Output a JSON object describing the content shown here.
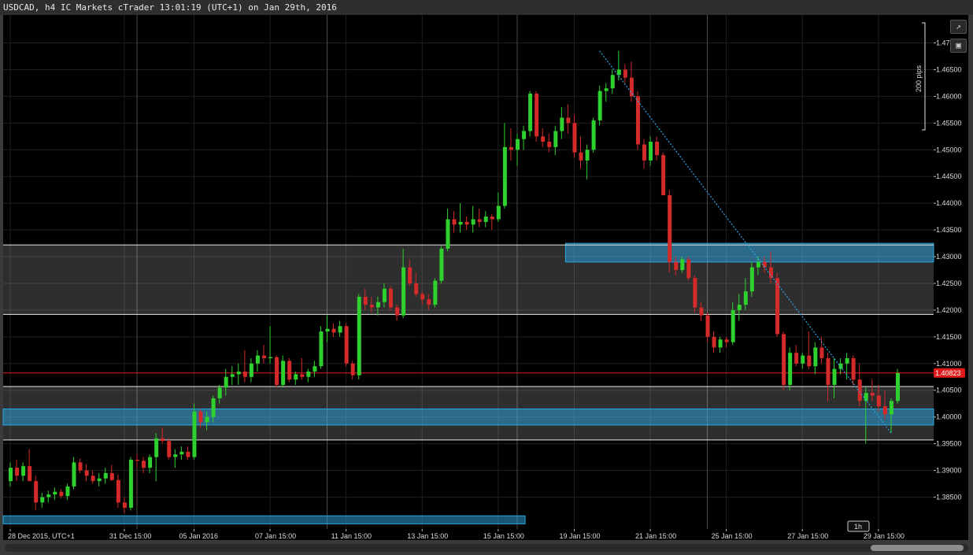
{
  "window": {
    "title": "USDCAD, h4 IC Markets cTrader 13:01:19 (UTC+1) on Jan 29th, 2016"
  },
  "toolbar": {
    "popout_icon": "↗",
    "camera_icon": "▣"
  },
  "colors": {
    "bull": "#2fd12f",
    "bear": "#d42a2a",
    "zone_fill": "#2a9fd6",
    "zone_border": "#29a8e0",
    "price_line": "#e01a1a",
    "trendline": "#2aa7e6",
    "bg": "#000000"
  },
  "chart_data": {
    "type": "candlestick",
    "symbol": "USDCAD",
    "timeframe": "h4",
    "ylim": [
      1.38,
      1.472
    ],
    "yticks": [
      "1.47",
      "1.46500",
      "1.46000",
      "1.45500",
      "1.45000",
      "1.44500",
      "1.44000",
      "1.43500",
      "1.43000",
      "1.42500",
      "1.42000",
      "1.41500",
      "1.41000",
      "1.40500",
      "1.40000",
      "1.39500",
      "1.39000",
      "1.38500"
    ],
    "ytick_values": [
      1.47,
      1.465,
      1.46,
      1.455,
      1.45,
      1.445,
      1.44,
      1.435,
      1.43,
      1.425,
      1.42,
      1.415,
      1.41,
      1.405,
      1.4,
      1.395,
      1.39,
      1.385
    ],
    "xticks": [
      "28 Dec 2015, UTC+1",
      "31 Dec 15:00",
      "05 Jan 2016",
      "07 Jan 15:00",
      "11 Jan 15:00",
      "13 Jan 15:00",
      "15 Jan 15:00",
      "19 Jan 15:00",
      "21 Jan 15:00",
      "25 Jan 15:00",
      "27 Jan 15:00",
      "29 Jan 15:00"
    ],
    "xtick_index": [
      0,
      18,
      29,
      41,
      53,
      65,
      77,
      89,
      101,
      113,
      125,
      137
    ],
    "current_price": "1.40823",
    "current_price_value": 1.40823,
    "scale_label": "200 pips",
    "period_label": "1h",
    "horizontal_lines": [
      1.4322,
      1.4192,
      1.4057,
      1.3957
    ],
    "zones": [
      {
        "from_index": 0,
        "to_index": 999,
        "top": 1.4322,
        "bottom": 1.4192,
        "style": "grey"
      },
      {
        "from_index": 0,
        "to_index": 999,
        "top": 1.4057,
        "bottom": 1.3957,
        "style": "grey"
      },
      {
        "from_index": 88,
        "to_index": 999,
        "top": 1.4325,
        "bottom": 1.429,
        "style": "blue"
      },
      {
        "from_index": 0,
        "to_index": 999,
        "top": 1.4015,
        "bottom": 1.3985,
        "style": "blue"
      },
      {
        "from_index": 0,
        "to_index": 81,
        "top": 1.3815,
        "bottom": 1.38,
        "style": "blue"
      }
    ],
    "trendline": {
      "from_index": 93,
      "from_price": 1.4685,
      "to_index": 139,
      "to_price": 1.397
    },
    "ohlc": [
      [
        1.388,
        1.3915,
        1.387,
        1.3905
      ],
      [
        1.3905,
        1.392,
        1.388,
        1.389
      ],
      [
        1.389,
        1.3915,
        1.388,
        1.3908
      ],
      [
        1.3908,
        1.394,
        1.389,
        1.388
      ],
      [
        1.388,
        1.389,
        1.3825,
        1.384
      ],
      [
        1.384,
        1.3858,
        1.383,
        1.385
      ],
      [
        1.385,
        1.3862,
        1.384,
        1.3855
      ],
      [
        1.3855,
        1.3868,
        1.3845,
        1.386
      ],
      [
        1.386,
        1.3865,
        1.3848,
        1.3852
      ],
      [
        1.3852,
        1.3875,
        1.3845,
        1.387
      ],
      [
        1.387,
        1.3925,
        1.3865,
        1.3915
      ],
      [
        1.3915,
        1.3922,
        1.3895,
        1.39
      ],
      [
        1.39,
        1.3912,
        1.388,
        1.389
      ],
      [
        1.389,
        1.39,
        1.3875,
        1.388
      ],
      [
        1.388,
        1.3895,
        1.387,
        1.3885
      ],
      [
        1.3885,
        1.3905,
        1.3875,
        1.3895
      ],
      [
        1.3895,
        1.391,
        1.388,
        1.3882
      ],
      [
        1.3882,
        1.3892,
        1.383,
        1.384
      ],
      [
        1.384,
        1.385,
        1.382,
        1.383
      ],
      [
        1.383,
        1.3925,
        1.3825,
        1.392
      ],
      [
        1.392,
        1.393,
        1.3905,
        1.3918
      ],
      [
        1.3918,
        1.3925,
        1.3895,
        1.3905
      ],
      [
        1.3905,
        1.393,
        1.3895,
        1.3925
      ],
      [
        1.3925,
        1.397,
        1.388,
        1.396
      ],
      [
        1.396,
        1.398,
        1.395,
        1.3955
      ],
      [
        1.3955,
        1.396,
        1.392,
        1.3925
      ],
      [
        1.3925,
        1.394,
        1.3905,
        1.393
      ],
      [
        1.393,
        1.3945,
        1.392,
        1.3935
      ],
      [
        1.3935,
        1.3945,
        1.392,
        1.3925
      ],
      [
        1.3925,
        1.4025,
        1.392,
        1.401
      ],
      [
        1.401,
        1.4015,
        1.398,
        1.399
      ],
      [
        1.399,
        1.401,
        1.3975,
        1.4
      ],
      [
        1.4,
        1.404,
        1.399,
        1.4035
      ],
      [
        1.4035,
        1.406,
        1.4025,
        1.4055
      ],
      [
        1.4055,
        1.409,
        1.404,
        1.4075
      ],
      [
        1.4075,
        1.4095,
        1.406,
        1.408
      ],
      [
        1.408,
        1.41,
        1.406,
        1.4085
      ],
      [
        1.4085,
        1.4125,
        1.4065,
        1.4075
      ],
      [
        1.4075,
        1.411,
        1.4065,
        1.41
      ],
      [
        1.41,
        1.4125,
        1.4085,
        1.4115
      ],
      [
        1.4115,
        1.4135,
        1.41,
        1.411
      ],
      [
        1.411,
        1.417,
        1.41,
        1.4112
      ],
      [
        1.4112,
        1.4115,
        1.4055,
        1.406
      ],
      [
        1.406,
        1.4115,
        1.4055,
        1.4105
      ],
      [
        1.4105,
        1.411,
        1.4065,
        1.407
      ],
      [
        1.407,
        1.4085,
        1.406,
        1.408
      ],
      [
        1.408,
        1.411,
        1.407,
        1.4075
      ],
      [
        1.4075,
        1.409,
        1.4065,
        1.4085
      ],
      [
        1.4085,
        1.4105,
        1.4075,
        1.4095
      ],
      [
        1.4095,
        1.417,
        1.409,
        1.416
      ],
      [
        1.416,
        1.419,
        1.414,
        1.4165
      ],
      [
        1.4165,
        1.4175,
        1.415,
        1.4158
      ],
      [
        1.4158,
        1.418,
        1.415,
        1.417
      ],
      [
        1.417,
        1.4175,
        1.4095,
        1.41
      ],
      [
        1.41,
        1.4105,
        1.407,
        1.4078
      ],
      [
        1.4078,
        1.423,
        1.407,
        1.4225
      ],
      [
        1.4225,
        1.424,
        1.42,
        1.421
      ],
      [
        1.421,
        1.4225,
        1.4195,
        1.4205
      ],
      [
        1.4205,
        1.4225,
        1.419,
        1.4215
      ],
      [
        1.4215,
        1.425,
        1.4205,
        1.424
      ],
      [
        1.424,
        1.4245,
        1.42,
        1.4205
      ],
      [
        1.4205,
        1.421,
        1.418,
        1.419
      ],
      [
        1.419,
        1.4315,
        1.4185,
        1.428
      ],
      [
        1.428,
        1.4295,
        1.4245,
        1.425
      ],
      [
        1.425,
        1.427,
        1.4225,
        1.423
      ],
      [
        1.423,
        1.4235,
        1.421,
        1.422
      ],
      [
        1.422,
        1.423,
        1.42,
        1.421
      ],
      [
        1.421,
        1.426,
        1.4205,
        1.4255
      ],
      [
        1.4255,
        1.432,
        1.425,
        1.4315
      ],
      [
        1.4315,
        1.439,
        1.431,
        1.437
      ],
      [
        1.437,
        1.4385,
        1.4345,
        1.436
      ],
      [
        1.436,
        1.44,
        1.4345,
        1.4365
      ],
      [
        1.4365,
        1.4375,
        1.435,
        1.436
      ],
      [
        1.436,
        1.4395,
        1.4345,
        1.437
      ],
      [
        1.437,
        1.439,
        1.4355,
        1.4365
      ],
      [
        1.4365,
        1.4385,
        1.4355,
        1.4375
      ],
      [
        1.4375,
        1.438,
        1.435,
        1.437
      ],
      [
        1.437,
        1.442,
        1.4365,
        1.4395
      ],
      [
        1.4395,
        1.455,
        1.439,
        1.4505
      ],
      [
        1.4505,
        1.454,
        1.448,
        1.45
      ],
      [
        1.45,
        1.453,
        1.447,
        1.452
      ],
      [
        1.452,
        1.4545,
        1.45,
        1.4535
      ],
      [
        1.4535,
        1.461,
        1.4525,
        1.4605
      ],
      [
        1.4605,
        1.461,
        1.4515,
        1.4525
      ],
      [
        1.4525,
        1.454,
        1.4505,
        1.4515
      ],
      [
        1.4515,
        1.453,
        1.4495,
        1.4505
      ],
      [
        1.4505,
        1.4545,
        1.449,
        1.4535
      ],
      [
        1.4535,
        1.458,
        1.452,
        1.456
      ],
      [
        1.456,
        1.4585,
        1.453,
        1.455
      ],
      [
        1.455,
        1.4565,
        1.4485,
        1.4495
      ],
      [
        1.4495,
        1.4525,
        1.4465,
        1.448
      ],
      [
        1.448,
        1.451,
        1.4445,
        1.45
      ],
      [
        1.45,
        1.456,
        1.4495,
        1.4555
      ],
      [
        1.4555,
        1.462,
        1.4545,
        1.461
      ],
      [
        1.461,
        1.4625,
        1.459,
        1.4615
      ],
      [
        1.4615,
        1.465,
        1.4605,
        1.464
      ],
      [
        1.464,
        1.4685,
        1.463,
        1.465
      ],
      [
        1.465,
        1.466,
        1.4625,
        1.4635
      ],
      [
        1.4635,
        1.4665,
        1.459,
        1.46
      ],
      [
        1.46,
        1.461,
        1.45,
        1.451
      ],
      [
        1.451,
        1.452,
        1.4465,
        1.448
      ],
      [
        1.448,
        1.4525,
        1.447,
        1.4515
      ],
      [
        1.4515,
        1.4525,
        1.448,
        1.449
      ],
      [
        1.449,
        1.4495,
        1.444,
        1.4415
      ],
      [
        1.4415,
        1.4425,
        1.427,
        1.429
      ],
      [
        1.429,
        1.43,
        1.4265,
        1.4275
      ],
      [
        1.4275,
        1.43,
        1.427,
        1.4295
      ],
      [
        1.4295,
        1.43,
        1.4255,
        1.426
      ],
      [
        1.426,
        1.4265,
        1.4195,
        1.4205
      ],
      [
        1.4205,
        1.4215,
        1.418,
        1.419
      ],
      [
        1.419,
        1.4195,
        1.414,
        1.415
      ],
      [
        1.415,
        1.416,
        1.412,
        1.413
      ],
      [
        1.413,
        1.415,
        1.412,
        1.4145
      ],
      [
        1.4145,
        1.415,
        1.413,
        1.414
      ],
      [
        1.414,
        1.4215,
        1.4135,
        1.42
      ],
      [
        1.42,
        1.423,
        1.418,
        1.421
      ],
      [
        1.421,
        1.426,
        1.42,
        1.4235
      ],
      [
        1.4235,
        1.429,
        1.4225,
        1.428
      ],
      [
        1.428,
        1.43,
        1.4265,
        1.429
      ],
      [
        1.429,
        1.43,
        1.427,
        1.428
      ],
      [
        1.428,
        1.431,
        1.425,
        1.426
      ],
      [
        1.426,
        1.427,
        1.415,
        1.4155
      ],
      [
        1.4155,
        1.416,
        1.405,
        1.406
      ],
      [
        1.406,
        1.413,
        1.405,
        1.412
      ],
      [
        1.412,
        1.4135,
        1.4095,
        1.41
      ],
      [
        1.41,
        1.412,
        1.409,
        1.4115
      ],
      [
        1.4115,
        1.416,
        1.409,
        1.4095
      ],
      [
        1.4095,
        1.414,
        1.408,
        1.413
      ],
      [
        1.413,
        1.415,
        1.41,
        1.411
      ],
      [
        1.411,
        1.412,
        1.403,
        1.406
      ],
      [
        1.406,
        1.411,
        1.4035,
        1.409
      ],
      [
        1.409,
        1.411,
        1.408,
        1.41
      ],
      [
        1.41,
        1.412,
        1.407,
        1.411
      ],
      [
        1.411,
        1.4115,
        1.406,
        1.407
      ],
      [
        1.407,
        1.41,
        1.402,
        1.403
      ],
      [
        1.403,
        1.4055,
        1.395,
        1.4045
      ],
      [
        1.4045,
        1.407,
        1.403,
        1.404
      ],
      [
        1.404,
        1.406,
        1.401,
        1.402
      ],
      [
        1.402,
        1.405,
        1.3995,
        1.4005
      ],
      [
        1.4005,
        1.4035,
        1.397,
        1.403
      ],
      [
        1.403,
        1.409,
        1.4025,
        1.4082
      ]
    ]
  }
}
